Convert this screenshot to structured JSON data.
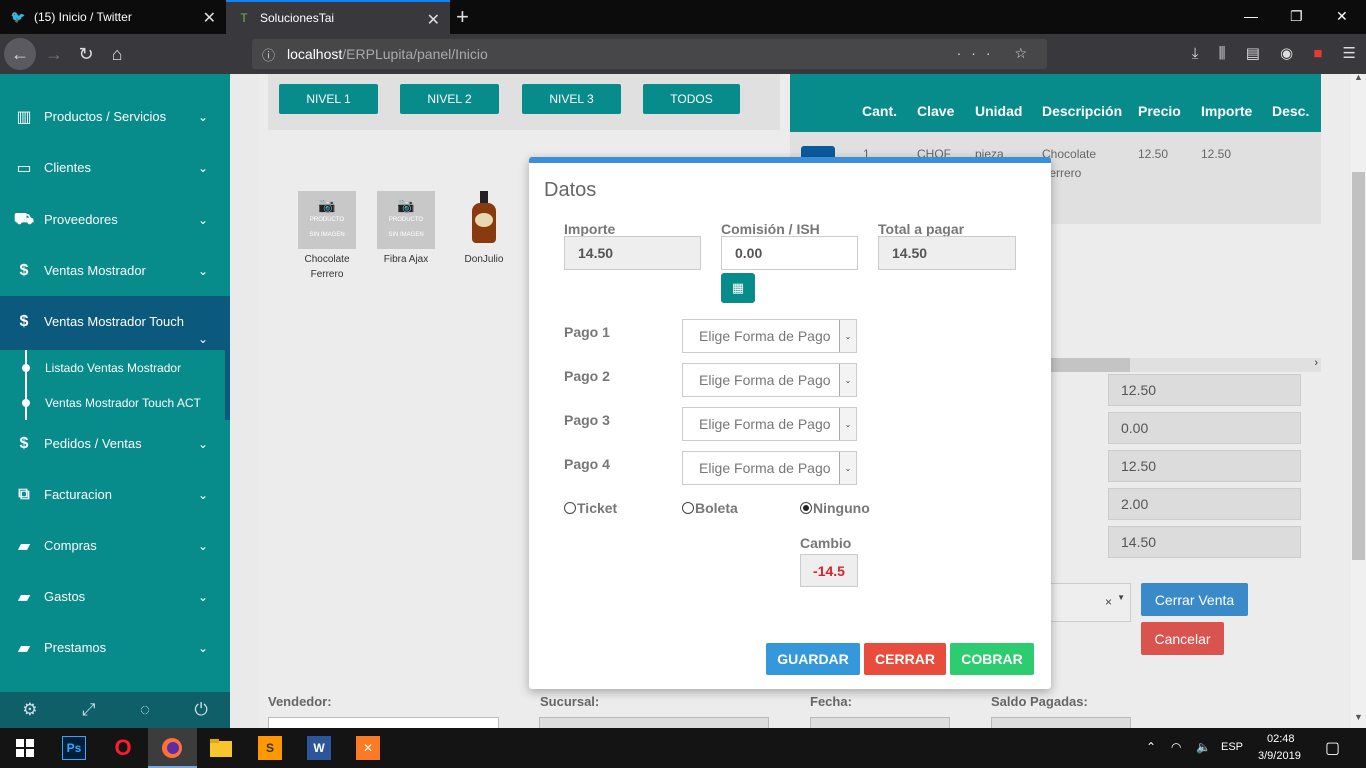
{
  "browser": {
    "tabs": [
      {
        "title": "(15) Inicio / Twitter",
        "active": false
      },
      {
        "title": "SolucionesTai",
        "active": true
      }
    ],
    "url_host": "localhost",
    "url_path": "/ERPLupita/panel/Inicio"
  },
  "sidebar": {
    "items": [
      {
        "label": "Productos / Servicios",
        "icon": "barcode-icon"
      },
      {
        "label": "Clientes",
        "icon": "card-icon"
      },
      {
        "label": "Proveedores",
        "icon": "truck-icon"
      },
      {
        "label": "Ventas Mostrador",
        "icon": "dollar-icon"
      },
      {
        "label": "Ventas Mostrador Touch",
        "icon": "dollar-icon"
      },
      {
        "label": "Pedidos / Ventas",
        "icon": "dollar-icon"
      },
      {
        "label": "Facturacion",
        "icon": "copy-icon"
      },
      {
        "label": "Compras",
        "icon": "briefcase-icon"
      },
      {
        "label": "Gastos",
        "icon": "briefcase-icon"
      },
      {
        "label": "Prestamos",
        "icon": "briefcase-icon"
      }
    ],
    "submenu": [
      "Listado Ventas Mostrador",
      "Ventas Mostrador Touch ACT"
    ]
  },
  "levels": [
    "NIVEL 1",
    "NIVEL 2",
    "NIVEL 3",
    "TODOS"
  ],
  "products": [
    {
      "name_line1": "Chocolate",
      "name_line2": "Ferrero",
      "img_text1": "PRODUCTO",
      "img_text2": "SIN IMAGEN"
    },
    {
      "name_line1": "Fibra Ajax",
      "name_line2": "",
      "img_text1": "PRODUCTO",
      "img_text2": "SIN IMAGEN"
    },
    {
      "name_line1": "DonJulio",
      "name_line2": ""
    }
  ],
  "table": {
    "headers": [
      "Cant.",
      "Clave",
      "Unidad",
      "Descripción",
      "Precio",
      "Importe",
      "Desc."
    ],
    "row": {
      "cant": "1",
      "clave": "CHOF",
      "unidad": "pieza",
      "desc_line1": "Chocolate",
      "desc_line2": "Ferrero",
      "precio": "12.50",
      "importe": "12.50"
    }
  },
  "summary": [
    "12.50",
    "0.00",
    "12.50",
    "2.00",
    "14.50"
  ],
  "select_clear": "×",
  "buttons": {
    "cerrar_venta": "Cerrar Venta",
    "cancelar": "Cancelar"
  },
  "footer": {
    "vendedor": "Vendedor:",
    "sucursal": "Sucursal:",
    "fecha": "Fecha:",
    "saldo": "Saldo Pagadas:"
  },
  "modal": {
    "title": "Datos",
    "importe_label": "Importe",
    "importe_value": "14.50",
    "comision_label": "Comisión / ISH",
    "comision_value": "0.00",
    "total_label": "Total a pagar",
    "total_value": "14.50",
    "pagos": [
      {
        "label": "Pago 1",
        "placeholder": "Elige Forma de Pago"
      },
      {
        "label": "Pago 2",
        "placeholder": "Elige Forma de Pago"
      },
      {
        "label": "Pago 3",
        "placeholder": "Elige Forma de Pago"
      },
      {
        "label": "Pago 4",
        "placeholder": "Elige Forma de Pago"
      }
    ],
    "radios": [
      {
        "label": "Ticket",
        "checked": false
      },
      {
        "label": "Boleta",
        "checked": false
      },
      {
        "label": "Ninguno",
        "checked": true
      }
    ],
    "cambio_label": "Cambio",
    "cambio_value": "-14.5",
    "btn_guardar": "GUARDAR",
    "btn_cerrar": "CERRAR",
    "btn_cobrar": "COBRAR"
  },
  "taskbar": {
    "lang": "ESP",
    "time": "02:48",
    "date": "3/9/2019"
  },
  "colors": {
    "teal": "#078b8b",
    "navy": "#0b5a7d",
    "blue": "#3a8fd8",
    "red": "#e74c3c",
    "green": "#2ecc71"
  }
}
